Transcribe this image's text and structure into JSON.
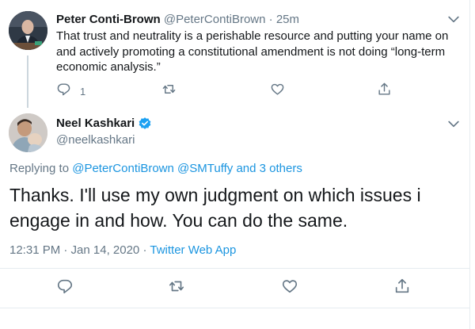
{
  "parent_tweet": {
    "name": "Peter Conti-Brown",
    "handle": "@PeterContiBrown",
    "separator": "·",
    "time": "25m",
    "text": "That trust and neutrality is a perishable resource and putting your name on and actively promoting a constitutional amendment is not doing “long-term economic analysis.”",
    "reply_count": "1",
    "icons": [
      "reply-icon",
      "retweet-icon",
      "like-icon",
      "share-icon",
      "chevron-down-icon"
    ]
  },
  "main_tweet": {
    "name": "Neel Kashkari",
    "verified": true,
    "handle": "@neelkashkari",
    "replying_prefix": "Replying to",
    "replying_mention_1": "@PeterContiBrown",
    "replying_mention_2": "@SMTuffy",
    "replying_and": "and",
    "replying_others": "3 others",
    "text": "Thanks. I'll use my own judgment on which issues i engage in and how.  You can do the same.",
    "timestamp": "12:31 PM · Jan 14, 2020",
    "meta_separator": "·",
    "source": "Twitter Web App",
    "icons": [
      "reply-icon",
      "retweet-icon",
      "like-icon",
      "share-icon",
      "chevron-down-icon",
      "verified-badge-icon"
    ]
  },
  "colors": {
    "text": "#14171a",
    "secondary": "#657786",
    "link": "#1b95e0",
    "border": "#e6ecf0",
    "thread_line": "#ccd6dd",
    "verified": "#1da1f2"
  }
}
